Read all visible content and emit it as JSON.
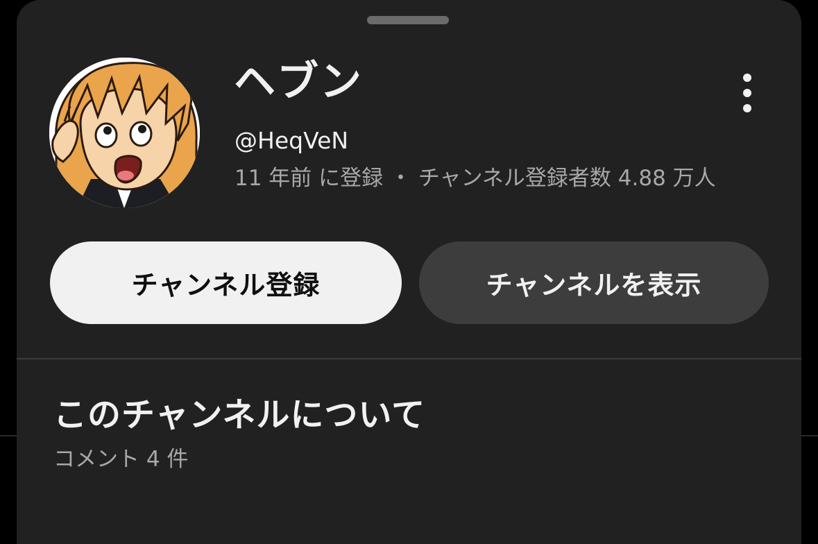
{
  "channel": {
    "name": "ヘブン",
    "handle": "@HeqVeN",
    "meta": "11 年前 に登録 ・ チャンネル登録者数 4.88 万人"
  },
  "buttons": {
    "subscribe_label": "チャンネル登録",
    "view_label": "チャンネルを表示"
  },
  "about": {
    "title": "このチャンネルについて",
    "comments": "コメント 4 件"
  },
  "icons": {
    "more": "more-vertical-icon",
    "avatar": "cartoon-avatar"
  },
  "colors": {
    "sheet_background": "#212121",
    "primary_text": "#f1f1f1",
    "secondary_text": "#a8a8a8",
    "subscribe_button": "#f1f1f1",
    "view_button": "#3d3d3d"
  }
}
